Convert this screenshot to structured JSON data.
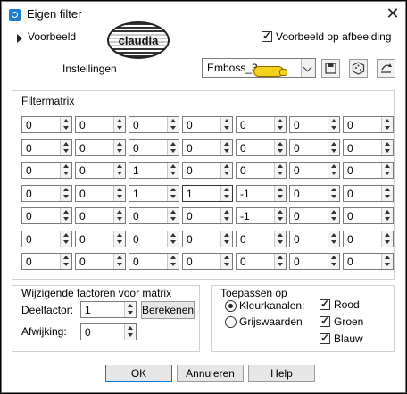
{
  "window": {
    "title": "Eigen filter",
    "close_glyph": "✕"
  },
  "preview": {
    "label": "Voorbeeld",
    "logo_text": "claudia",
    "on_image_label": "Voorbeeld op afbeelding",
    "on_image_checked": true
  },
  "settings": {
    "label": "Instellingen",
    "preset": "Emboss_3",
    "icons": [
      "save-preset-icon",
      "randomize-icon",
      "reset-icon"
    ]
  },
  "matrix": {
    "title": "Filtermatrix",
    "rows": [
      [
        "0",
        "0",
        "0",
        "0",
        "0",
        "0",
        "0"
      ],
      [
        "0",
        "0",
        "0",
        "0",
        "0",
        "0",
        "0"
      ],
      [
        "0",
        "0",
        "1",
        "0",
        "0",
        "0",
        "0"
      ],
      [
        "0",
        "0",
        "1",
        "1",
        "-1",
        "0",
        "0"
      ],
      [
        "0",
        "0",
        "0",
        "0",
        "-1",
        "0",
        "0"
      ],
      [
        "0",
        "0",
        "0",
        "0",
        "0",
        "0",
        "0"
      ],
      [
        "0",
        "0",
        "0",
        "0",
        "0",
        "0",
        "0"
      ]
    ]
  },
  "factors": {
    "title": "Wijzigende factoren voor matrix",
    "divisor_label": "Deelfactor:",
    "divisor_value": "1",
    "compute_label": "Berekenen",
    "bias_label": "Afwijking:",
    "bias_value": "0"
  },
  "apply": {
    "title": "Toepassen op",
    "color_channels_label": "Kleurkanalen:",
    "grayscale_label": "Grijswaarden",
    "selected": "Kleurkanalen:",
    "red_label": "Rood",
    "green_label": "Groen",
    "blue_label": "Blauw",
    "red_checked": true,
    "green_checked": true,
    "blue_checked": true
  },
  "footer": {
    "ok_label": "OK",
    "cancel_label": "Annuleren",
    "help_label": "Help"
  },
  "colors": {
    "accent": "#0078d7",
    "frame": "#000000",
    "pointer": "#f3d21d"
  }
}
